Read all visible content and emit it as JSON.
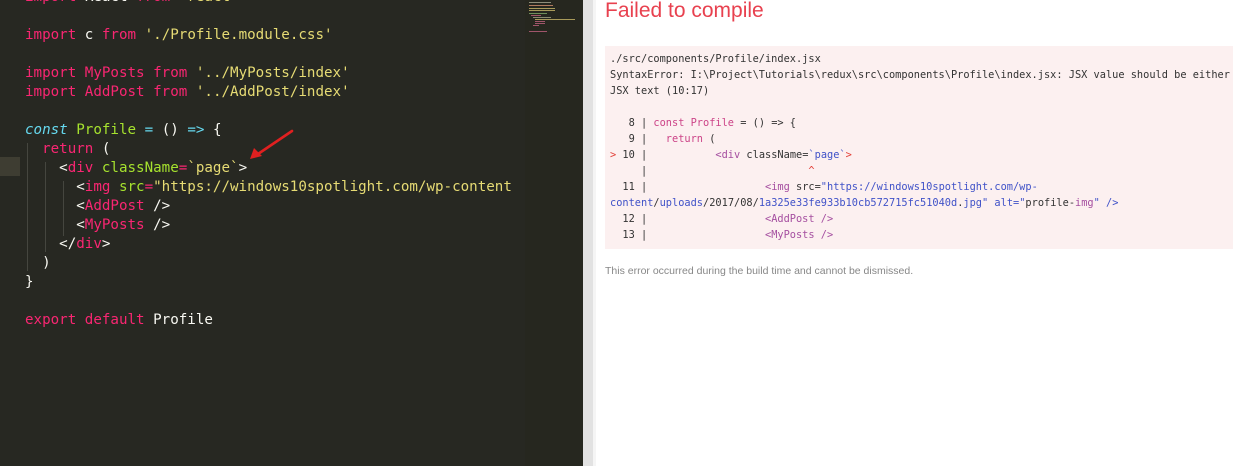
{
  "editor": {
    "code_lines": [
      "import React from 'react'",
      "",
      "import c from './Profile.module.css'",
      "",
      "import MyPosts from '../MyPosts/index'",
      "import AddPost from '../AddPost/index'",
      "",
      "const Profile = () => {",
      "  return (",
      "    <div className=`page`>",
      "      <img src=\"https://windows10spotlight.com/wp-content",
      "      <AddPost />",
      "      <MyPosts />",
      "    </div>",
      "  )",
      "}",
      "",
      "export default Profile"
    ],
    "arrow_color": "#e02020"
  },
  "overlay": {
    "title": "Failed to compile",
    "file_path": "./src/components/Profile/index.jsx",
    "error_message_1": "SyntaxError: I:\\Project\\Tutorials\\redux\\src\\components\\Profile\\index.jsx: JSX value should be either an",
    "error_message_2": "JSX text (10:17)",
    "code_frame": [
      "   8 | const Profile = () => {",
      "   9 |   return (",
      "> 10 |           <div className=`page`>",
      "     |                          ^",
      "  11 |                   <img src=\"https://windows10spotlight.com/wp-",
      "content/uploads/2017/08/1a325e33fe933b10cb572715fc51040d.jpg\" alt=\"profile-img\" />",
      "  12 |                   <AddPost />",
      "  13 |                   <MyPosts />"
    ],
    "footer": "This error occurred during the build time and cannot be dismissed.",
    "title_color": "#e8414f",
    "box_background": "#fcf0f0"
  }
}
